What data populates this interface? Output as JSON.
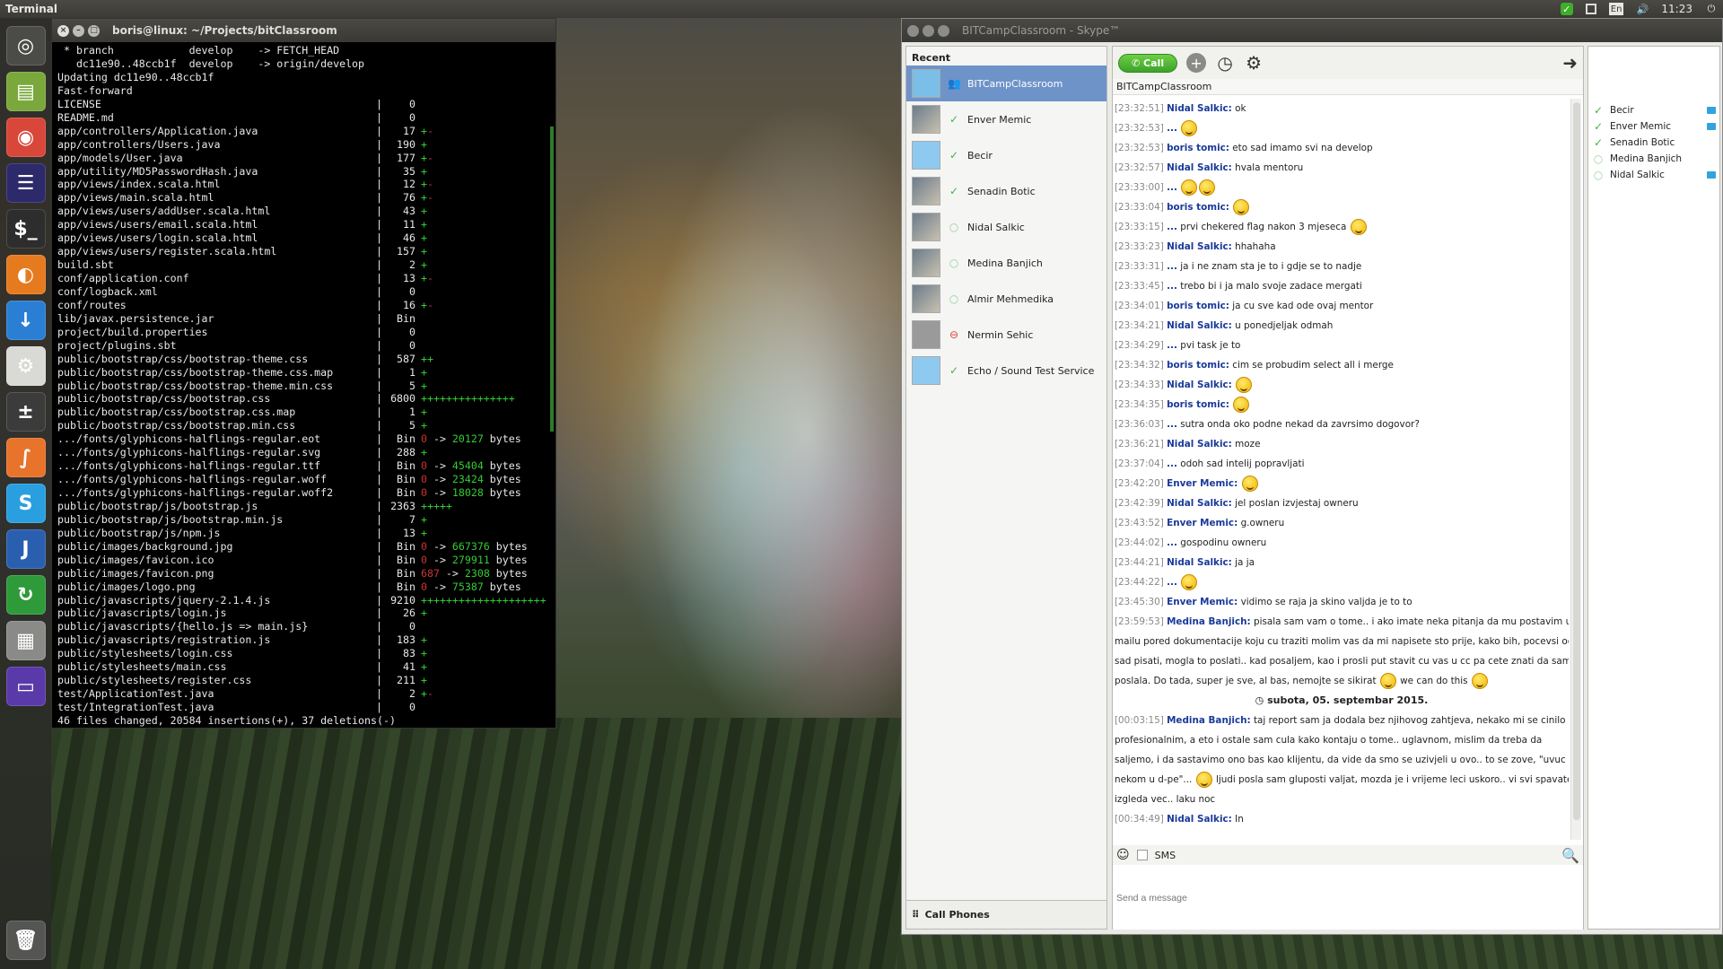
{
  "top_panel": {
    "app_name": "Terminal",
    "keyboard": "En",
    "clock": "11:23"
  },
  "launcher": {
    "items": [
      {
        "name": "ubuntu-dash",
        "glyph": "◎",
        "color": "#4b4b48"
      },
      {
        "name": "files",
        "glyph": "▤",
        "color": "#7aa83c"
      },
      {
        "name": "chrome",
        "glyph": "◉",
        "color": "#d9463a"
      },
      {
        "name": "eclipse",
        "glyph": "☰",
        "color": "#2d2a6b"
      },
      {
        "name": "terminal",
        "glyph": "$_",
        "color": "#2d2d2d"
      },
      {
        "name": "firefox",
        "glyph": "◐",
        "color": "#e67a1f"
      },
      {
        "name": "downloads",
        "glyph": "↓",
        "color": "#2a7fd4"
      },
      {
        "name": "settings",
        "glyph": "⚙",
        "color": "#d9d9d6"
      },
      {
        "name": "calculator",
        "glyph": "±",
        "color": "#3b3b3b"
      },
      {
        "name": "sublime",
        "glyph": "∫",
        "color": "#e8732a"
      },
      {
        "name": "skype",
        "glyph": "S",
        "color": "#2a9fe0"
      },
      {
        "name": "intellij",
        "glyph": "J",
        "color": "#2a5fb0"
      },
      {
        "name": "update",
        "glyph": "↻",
        "color": "#2e9a3a"
      },
      {
        "name": "workspaces",
        "glyph": "▦",
        "color": "#8a8a88"
      },
      {
        "name": "desktop",
        "glyph": "▭",
        "color": "#5a3aa8"
      }
    ],
    "trash_glyph": "🗑"
  },
  "terminal": {
    "title": "boris@linux: ~/Projects/bitClassroom",
    "header_lines": [
      " * branch            develop    -> FETCH_HEAD",
      "   dc11e90..48ccb1f  develop    -> origin/develop",
      "Updating dc11e90..48ccb1f",
      "Fast-forward"
    ],
    "files": [
      {
        "path": "LICENSE",
        "count": "0",
        "plus": "",
        "minus": ""
      },
      {
        "path": "README.md",
        "count": "0",
        "plus": "",
        "minus": ""
      },
      {
        "path": "app/controllers/Application.java",
        "count": "17",
        "plus": "+",
        "minus": "-"
      },
      {
        "path": "app/controllers/Users.java",
        "count": "190",
        "plus": "+",
        "minus": ""
      },
      {
        "path": "app/models/User.java",
        "count": "177",
        "plus": "+",
        "minus": "-"
      },
      {
        "path": "app/utility/MD5PasswordHash.java",
        "count": "35",
        "plus": "+",
        "minus": ""
      },
      {
        "path": "app/views/index.scala.html",
        "count": "12",
        "plus": "+",
        "minus": "-"
      },
      {
        "path": "app/views/main.scala.html",
        "count": "76",
        "plus": "+",
        "minus": "-"
      },
      {
        "path": "app/views/users/addUser.scala.html",
        "count": "43",
        "plus": "+",
        "minus": ""
      },
      {
        "path": "app/views/users/email.scala.html",
        "count": "11",
        "plus": "+",
        "minus": ""
      },
      {
        "path": "app/views/users/login.scala.html",
        "count": "46",
        "plus": "+",
        "minus": ""
      },
      {
        "path": "app/views/users/register.scala.html",
        "count": "157",
        "plus": "+",
        "minus": ""
      },
      {
        "path": "build.sbt",
        "count": "2",
        "plus": "+",
        "minus": ""
      },
      {
        "path": "conf/application.conf",
        "count": "13",
        "plus": "+",
        "minus": "-"
      },
      {
        "path": "conf/logback.xml",
        "count": "0",
        "plus": "",
        "minus": ""
      },
      {
        "path": "conf/routes",
        "count": "16",
        "plus": "+",
        "minus": "-"
      },
      {
        "path": "lib/javax.persistence.jar",
        "count": "Bin",
        "plus": "",
        "minus": ""
      },
      {
        "path": "project/build.properties",
        "count": "0",
        "plus": "",
        "minus": ""
      },
      {
        "path": "project/plugins.sbt",
        "count": "0",
        "plus": "",
        "minus": ""
      },
      {
        "path": "public/bootstrap/css/bootstrap-theme.css",
        "count": "587",
        "plus": "++",
        "minus": ""
      },
      {
        "path": "public/bootstrap/css/bootstrap-theme.css.map",
        "count": "1",
        "plus": "+",
        "minus": ""
      },
      {
        "path": "public/bootstrap/css/bootstrap-theme.min.css",
        "count": "5",
        "plus": "+",
        "minus": ""
      },
      {
        "path": "public/bootstrap/css/bootstrap.css",
        "count": "6800",
        "plus": "+++++++++++++++",
        "minus": ""
      },
      {
        "path": "public/bootstrap/css/bootstrap.css.map",
        "count": "1",
        "plus": "+",
        "minus": ""
      },
      {
        "path": "public/bootstrap/css/bootstrap.min.css",
        "count": "5",
        "plus": "+",
        "minus": ""
      },
      {
        "path": ".../fonts/glyphicons-halflings-regular.eot",
        "count": "Bin",
        "bin_from": "0",
        "bin_to": "20127",
        "unit": "bytes"
      },
      {
        "path": ".../fonts/glyphicons-halflings-regular.svg",
        "count": "288",
        "plus": "+",
        "minus": ""
      },
      {
        "path": ".../fonts/glyphicons-halflings-regular.ttf",
        "count": "Bin",
        "bin_from": "0",
        "bin_to": "45404",
        "unit": "bytes"
      },
      {
        "path": ".../fonts/glyphicons-halflings-regular.woff",
        "count": "Bin",
        "bin_from": "0",
        "bin_to": "23424",
        "unit": "bytes"
      },
      {
        "path": ".../fonts/glyphicons-halflings-regular.woff2",
        "count": "Bin",
        "bin_from": "0",
        "bin_to": "18028",
        "unit": "bytes"
      },
      {
        "path": "public/bootstrap/js/bootstrap.js",
        "count": "2363",
        "plus": "+++++",
        "minus": ""
      },
      {
        "path": "public/bootstrap/js/bootstrap.min.js",
        "count": "7",
        "plus": "+",
        "minus": ""
      },
      {
        "path": "public/bootstrap/js/npm.js",
        "count": "13",
        "plus": "+",
        "minus": ""
      },
      {
        "path": "public/images/background.jpg",
        "count": "Bin",
        "bin_from": "0",
        "bin_to": "667376",
        "unit": "bytes"
      },
      {
        "path": "public/images/favicon.ico",
        "count": "Bin",
        "bin_from": "0",
        "bin_to": "279911",
        "unit": "bytes"
      },
      {
        "path": "public/images/favicon.png",
        "count": "Bin",
        "bin_from": "687",
        "bin_to": "2308",
        "unit": "bytes"
      },
      {
        "path": "public/images/logo.png",
        "count": "Bin",
        "bin_from": "0",
        "bin_to": "75387",
        "unit": "bytes"
      },
      {
        "path": "public/javascripts/jquery-2.1.4.js",
        "count": "9210",
        "plus": "++++++++++++++++++++",
        "minus": ""
      },
      {
        "path": "public/javascripts/login.js",
        "count": "26",
        "plus": "+",
        "minus": ""
      },
      {
        "path": "public/javascripts/{hello.js => main.js}",
        "count": "0",
        "plus": "",
        "minus": ""
      },
      {
        "path": "public/javascripts/registration.js",
        "count": "183",
        "plus": "+",
        "minus": ""
      },
      {
        "path": "public/stylesheets/login.css",
        "count": "83",
        "plus": "+",
        "minus": ""
      },
      {
        "path": "public/stylesheets/main.css",
        "count": "41",
        "plus": "+",
        "minus": ""
      },
      {
        "path": "public/stylesheets/register.css",
        "count": "211",
        "plus": "+",
        "minus": ""
      },
      {
        "path": "test/ApplicationTest.java",
        "count": "2",
        "plus": "+",
        "minus": "-"
      },
      {
        "path": "test/IntegrationTest.java",
        "count": "0",
        "plus": "",
        "minus": ""
      }
    ],
    "summary": "46 files changed, 20584 insertions(+), 37 deletions(-)"
  },
  "skype": {
    "title": "BITCampClassroom - Skype™",
    "recent_label": "Recent",
    "contacts": [
      {
        "name": "BITCampClassroom",
        "status": "group",
        "selected": true
      },
      {
        "name": "Enver Memic",
        "status": "online"
      },
      {
        "name": "Becir",
        "status": "online"
      },
      {
        "name": "Senadin Botic",
        "status": "online"
      },
      {
        "name": "Nidal Salkic",
        "status": "offline"
      },
      {
        "name": "Medina Banjich",
        "status": "offline"
      },
      {
        "name": "Almir Mehmedika",
        "status": "offline"
      },
      {
        "name": "Nermin Sehic",
        "status": "dnd"
      },
      {
        "name": "Echo / Sound Test Service",
        "status": "online"
      }
    ],
    "call_phones": "Call Phones",
    "call_button": "Call",
    "conversation_title": "BITCampClassroom",
    "messages": [
      {
        "ts": "[23:32:51]",
        "author": "Nidal Salkic:",
        "text": "ok",
        "smileys": 0
      },
      {
        "ts": "[23:32:53]",
        "author": "...",
        "text": "",
        "smileys": 1
      },
      {
        "ts": "[23:32:53]",
        "author": "boris tomic:",
        "text": "eto sad imamo svi na develop",
        "smileys": 0
      },
      {
        "ts": "[23:32:57]",
        "author": "Nidal Salkic:",
        "text": "hvala mentoru",
        "smileys": 0
      },
      {
        "ts": "[23:33:00]",
        "author": "...",
        "text": "",
        "smileys": 2
      },
      {
        "ts": "[23:33:04]",
        "author": "boris tomic:",
        "text": "",
        "smileys": 1
      },
      {
        "ts": "[23:33:15]",
        "author": "...",
        "text": "prvi chekered flag nakon 3 mjeseca",
        "smileys": 1
      },
      {
        "ts": "[23:33:23]",
        "author": "Nidal Salkic:",
        "text": "hhahaha",
        "smileys": 0
      },
      {
        "ts": "[23:33:31]",
        "author": "...",
        "text": "ja i ne znam sta je to i gdje se to nadje",
        "smileys": 0
      },
      {
        "ts": "[23:33:45]",
        "author": "...",
        "text": "trebo bi i ja malo svoje zadace mergati",
        "smileys": 0
      },
      {
        "ts": "[23:34:01]",
        "author": "boris tomic:",
        "text": "ja cu sve kad ode ovaj mentor",
        "smileys": 0
      },
      {
        "ts": "[23:34:21]",
        "author": "Nidal Salkic:",
        "text": "u ponedjeljak odmah",
        "smileys": 0
      },
      {
        "ts": "[23:34:29]",
        "author": "...",
        "text": "pvi task je to",
        "smileys": 0
      },
      {
        "ts": "[23:34:32]",
        "author": "boris tomic:",
        "text": "cim se probudim select all i merge",
        "smileys": 0
      },
      {
        "ts": "[23:34:33]",
        "author": "Nidal Salkic:",
        "text": "",
        "smileys": 1
      },
      {
        "ts": "[23:34:35]",
        "author": "boris tomic:",
        "text": "",
        "smileys": 1
      },
      {
        "ts": "[23:36:03]",
        "author": "...",
        "text": "sutra onda oko podne nekad da zavrsimo dogovor?",
        "smileys": 0
      },
      {
        "ts": "[23:36:21]",
        "author": "Nidal Salkic:",
        "text": "moze",
        "smileys": 0
      },
      {
        "ts": "[23:37:04]",
        "author": "...",
        "text": "odoh sad intelij popravljati",
        "smileys": 0
      },
      {
        "ts": "[23:42:20]",
        "author": "Enver Memic:",
        "text": "",
        "smileys": 1
      },
      {
        "ts": "[23:42:39]",
        "author": "Nidal Salkic:",
        "text": "jel poslan izvjestaj owneru",
        "smileys": 0
      },
      {
        "ts": "[23:43:52]",
        "author": "Enver Memic:",
        "text": "g.owneru",
        "smileys": 0
      },
      {
        "ts": "[23:44:02]",
        "author": "...",
        "text": "gospodinu owneru",
        "smileys": 0
      },
      {
        "ts": "[23:44:21]",
        "author": "Nidal Salkic:",
        "text": "ja ja",
        "smileys": 0
      },
      {
        "ts": "[23:44:22]",
        "author": "...",
        "text": "",
        "smileys": 1
      },
      {
        "ts": "[23:45:30]",
        "author": "Enver Memic:",
        "text": "vidimo se raja ja skino valjda je to to",
        "smileys": 0
      },
      {
        "ts": "[23:59:53]",
        "author": "Medina Banjich:",
        "text": "pisala sam vam o tome.. i ako imate neka pitanja da mu postavim u",
        "smileys": 0
      },
      {
        "ts": "",
        "author": "",
        "text": "mailu pored dokumentacije koju cu traziti molim vas da mi napisete sto prije, kako bih, pocevsi od",
        "smileys": 0
      },
      {
        "ts": "",
        "author": "",
        "text": "sad pisati, mogla to poslati.. kad posaljem, kao i prosli put stavit cu vas u cc pa cete znati da sam",
        "smileys": 0
      },
      {
        "ts": "",
        "author": "",
        "text": "poslala. Do tada, super je sve, al bas, nemojte se sikirat",
        "smileys": 1,
        "after": "we can do this"
      },
      {
        "day": "subota, 05. septembar 2015."
      },
      {
        "ts": "[00:03:15]",
        "author": "Medina Banjich:",
        "text": "taj report sam ja dodala bez njihovog zahtjeva, nekako mi se cinilo",
        "smileys": 0
      },
      {
        "ts": "",
        "author": "",
        "text": "profesionalnim, a eto i ostale sam cula kako kontaju o tome.. uglavnom, mislim da treba da",
        "smileys": 0
      },
      {
        "ts": "",
        "author": "",
        "text": "saljemo, i da sastavimo ono bas kao klijentu, da vide da smo se uzivjeli u ovo.. to se zove, \"uvuc se",
        "smileys": 0
      },
      {
        "ts": "",
        "author": "",
        "text": "nekom u d-pe\"...",
        "smileys": 1,
        "after": "ljudi posla sam gluposti valjat, mozda je i vrijeme leci uskoro.. vi svi spavate"
      },
      {
        "ts": "",
        "author": "",
        "text": "izgleda vec.. laku noc",
        "smileys": 0
      },
      {
        "ts": "[00:34:49]",
        "author": "Nidal Salkic:",
        "text": "In",
        "smileys": 0
      }
    ],
    "sms_label": "SMS",
    "message_placeholder": "Send a message",
    "participants": [
      {
        "name": "Becir",
        "status": "online",
        "video": true
      },
      {
        "name": "Enver Memic",
        "status": "online",
        "video": true
      },
      {
        "name": "Senadin Botic",
        "status": "online",
        "video": false
      },
      {
        "name": "Medina Banjich",
        "status": "offline",
        "video": false
      },
      {
        "name": "Nidal Salkic",
        "status": "offline",
        "video": true
      }
    ]
  }
}
